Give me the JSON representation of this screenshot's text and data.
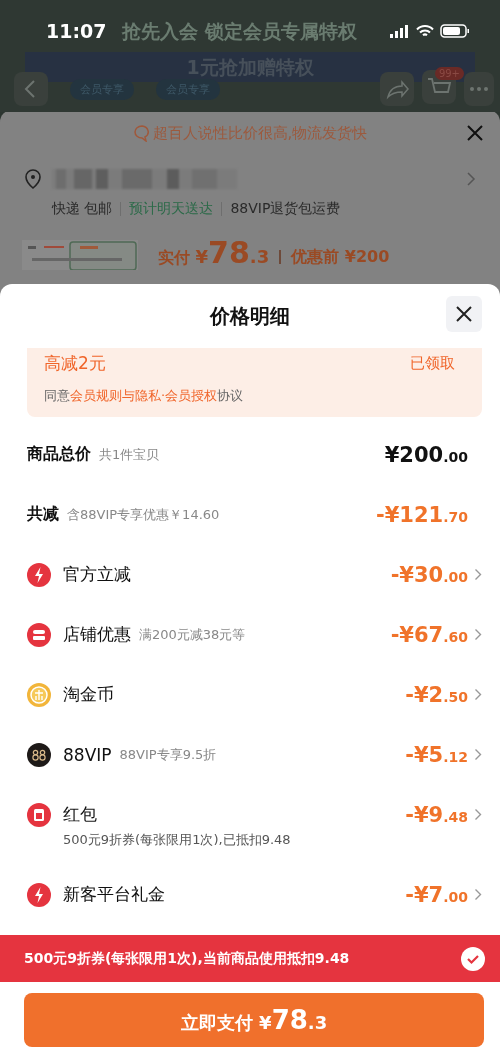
{
  "status_bar": {
    "time": "11:07"
  },
  "backdrop": {
    "banner_title": "抢先入会 锁定会员专属特权",
    "banner_subtitle": "1元抢加赠特权",
    "tags": [
      "会员专享",
      "会员专享"
    ],
    "cart_badge": "99+"
  },
  "back_sheet": {
    "review": "超百人说性比价很高,物流发货快",
    "shipping": [
      {
        "text": "快递 包邮",
        "highlight": false
      },
      {
        "text": "预计明天送达",
        "highlight": true
      },
      {
        "text": "88VIP退货包运费",
        "highlight": false
      }
    ],
    "paid_label": "实付",
    "paid_currency": "¥",
    "paid_amount": "78",
    "paid_cents": ".3",
    "original_price": "优惠前 ¥200"
  },
  "sheet": {
    "title": "价格明细",
    "coupon": {
      "title": "高减2元",
      "status": "已领取",
      "agree_prefix": "同意",
      "agree_link": "会员规则与隐私·会员授权",
      "agree_suffix": "协议"
    },
    "rows": [
      {
        "kind": "total",
        "label": "商品总价",
        "note": "共1件宝贝",
        "amount": "¥200",
        "cents": ".00"
      },
      {
        "kind": "summary",
        "label": "共减",
        "note": "含88VIP专享优惠￥14.60",
        "amount": "-¥121",
        "cents": ".70"
      },
      {
        "kind": "instant",
        "label": "官方立减",
        "amount": "-¥30",
        "cents": ".00"
      },
      {
        "kind": "shop",
        "label": "店铺优惠",
        "note": "满200元减38元等",
        "amount": "-¥67",
        "cents": ".60"
      },
      {
        "kind": "coin",
        "label": "淘金币",
        "amount": "-¥2",
        "cents": ".50"
      },
      {
        "kind": "vip",
        "label": "88VIP",
        "note": "88VIP专享9.5折",
        "amount": "-¥5",
        "cents": ".12"
      },
      {
        "kind": "packet",
        "label": "红包",
        "amount": "-¥9",
        "cents": ".48",
        "detail": "500元9折券(每张限用1次),已抵扣9.48"
      },
      {
        "kind": "instant",
        "label": "新客平台礼金",
        "amount": "-¥7",
        "cents": ".00"
      }
    ],
    "toast": {
      "text": "500元9折券(每张限用1次),当前商品使用抵扣9.48",
      "checked": true
    },
    "pay_button": {
      "label": "立即支付",
      "currency": "¥",
      "amount": "78",
      "cents": ".3"
    }
  }
}
